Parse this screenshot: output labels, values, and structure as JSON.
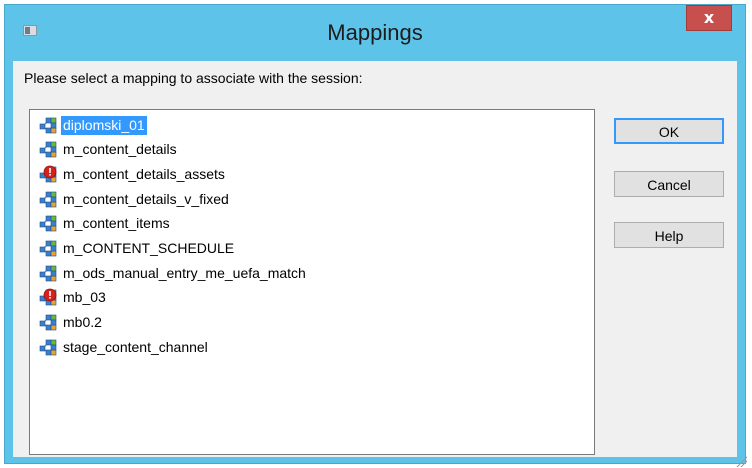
{
  "dialog": {
    "title": "Mappings",
    "close_label": "x",
    "prompt": "Please select a mapping to associate with the session:"
  },
  "mappings": [
    {
      "label": "diplomski_01",
      "status": "valid",
      "selected": true
    },
    {
      "label": "m_content_details",
      "status": "valid",
      "selected": false
    },
    {
      "label": "m_content_details_assets",
      "status": "invalid",
      "selected": false
    },
    {
      "label": "m_content_details_v_fixed",
      "status": "valid",
      "selected": false
    },
    {
      "label": "m_content_items",
      "status": "valid",
      "selected": false
    },
    {
      "label": "m_CONTENT_SCHEDULE",
      "status": "valid",
      "selected": false
    },
    {
      "label": "m_ods_manual_entry_me_uefa_match",
      "status": "valid",
      "selected": false
    },
    {
      "label": "mb_03",
      "status": "invalid",
      "selected": false
    },
    {
      "label": "mb0.2",
      "status": "valid",
      "selected": false
    },
    {
      "label": "stage_content_channel",
      "status": "valid",
      "selected": false
    }
  ],
  "buttons": {
    "ok": "OK",
    "cancel": "Cancel",
    "help": "Help"
  },
  "icons": {
    "valid_mapping": "mapping-icon",
    "invalid_mapping": "invalid-mapping-icon",
    "close": "close-icon",
    "system_menu": "window-icon"
  },
  "colors": {
    "title_bar": "#5ec3e8",
    "close_button": "#c7504f",
    "selection": "#3399ff",
    "client_area": "#f0f0f0"
  }
}
